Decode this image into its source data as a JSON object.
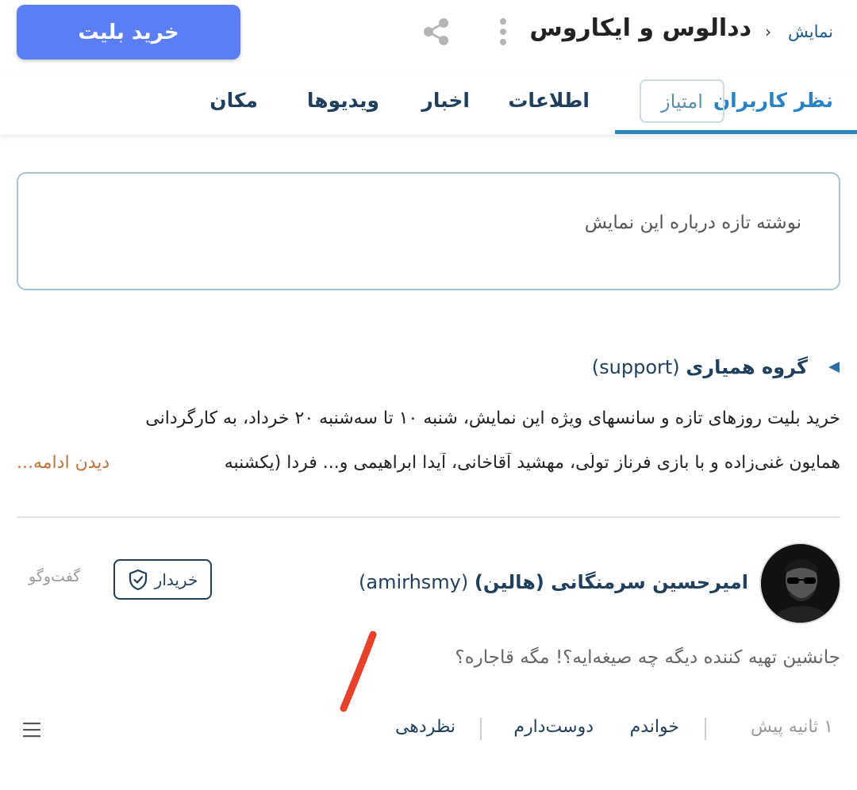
{
  "header": {
    "buy_button": "خرید بلیت",
    "title": "ددالوس و ایکاروس",
    "breadcrumb_separator": "›",
    "breadcrumb": "نمایش",
    "icons": [
      "share-icon",
      "more-vertical-icon"
    ]
  },
  "tabs": [
    {
      "label": "نظر کاربران",
      "active": true
    },
    {
      "label": "امتیاز"
    },
    {
      "label": "اطلاعات"
    },
    {
      "label": "اخبار"
    },
    {
      "label": "ویدیوها"
    },
    {
      "label": "مکان"
    }
  ],
  "compose": {
    "placeholder": "نوشته تازه درباره این نمایش"
  },
  "support_post": {
    "author_name": "گروه همیاری",
    "author_handle": "(support)",
    "line1": "خرید بلیت روزهای تازه و سانسهای ویژه این نمایش، شنبه ۱۰ تا سه‌شنبه ۲۰ خرداد، به کارگردانی",
    "line2": "همایون غنی‌زاده و با بازی فرناز تولّی، مهشید آقاخانی، آیدا ابراهیمی و... فردا (یکشنبه",
    "see_more": "دیدن ادامه..."
  },
  "comment": {
    "author_name": "امیرحسین سرمنگانی (هالین)",
    "author_handle": "(amirhsmy)",
    "badge": "خریدار",
    "chat_label": "گفت‌وگو",
    "text": "جانشین تهیه کننده دیگه چه صیغه‌ایه؟! مگه قاجاره؟",
    "time": "۱ ثانیه پیش",
    "actions": {
      "read": "خواندم",
      "like": "دوست‌دارم",
      "comment": "نظردهی"
    }
  },
  "colors": {
    "primary": "#5b7ef4",
    "tab_active": "#2a84c4",
    "navy": "#1f3f5c",
    "see_more": "#c0703a",
    "annotation": "#e8412a"
  }
}
